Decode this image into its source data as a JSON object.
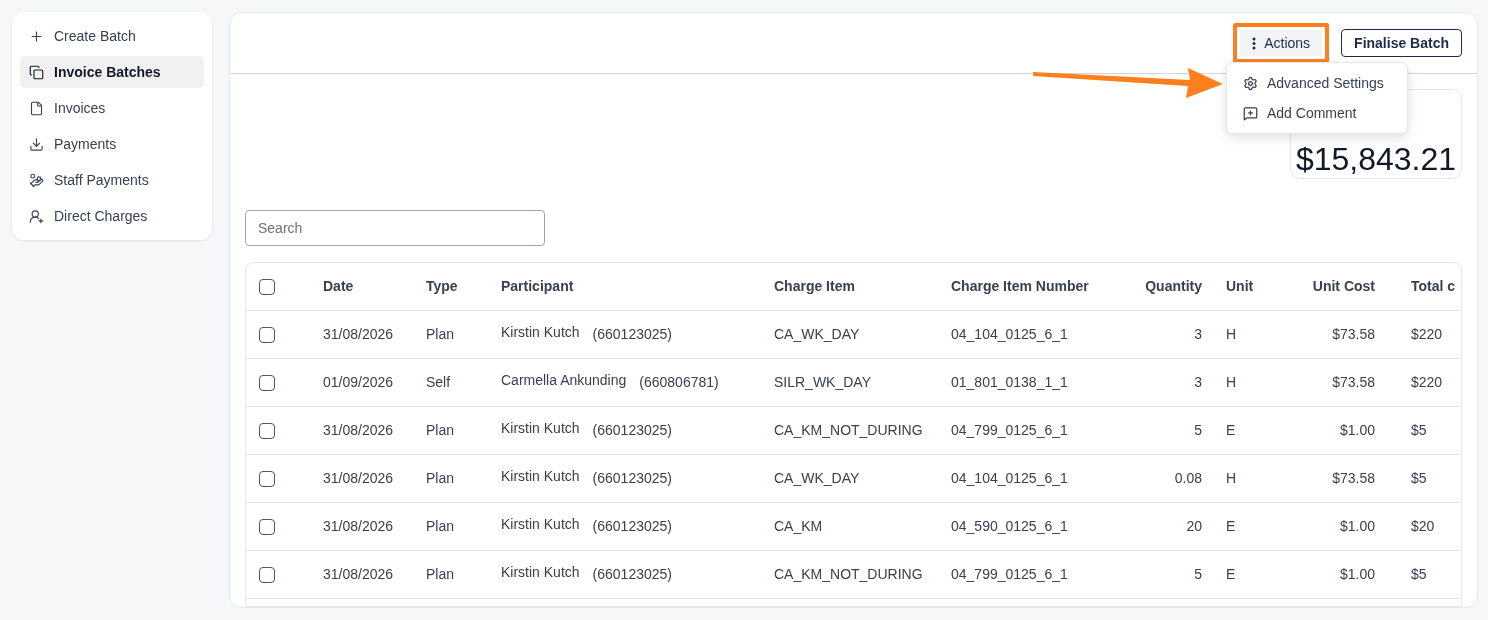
{
  "sidebar": {
    "items": [
      {
        "label": "Create Batch",
        "selected": false
      },
      {
        "label": "Invoice Batches",
        "selected": true
      },
      {
        "label": "Invoices",
        "selected": false
      },
      {
        "label": "Payments",
        "selected": false
      },
      {
        "label": "Staff Payments",
        "selected": false
      },
      {
        "label": "Direct Charges",
        "selected": false
      }
    ]
  },
  "header": {
    "actions_button": {
      "label": "Actions",
      "highlighted": true
    },
    "finalise_button": {
      "label": "Finalise Batch"
    }
  },
  "actions_menu": {
    "open": true,
    "pointed_at": true,
    "items": [
      {
        "label": "Advanced Settings"
      },
      {
        "label": "Add Comment"
      }
    ]
  },
  "summary": {
    "amount": "$15,843.21"
  },
  "search": {
    "placeholder": "Search"
  },
  "table": {
    "all_checked": false,
    "columns": [
      "Date",
      "Type",
      "Participant",
      "Charge Item",
      "Charge Item Number",
      "Quantity",
      "Unit",
      "Unit Cost",
      "Total c"
    ],
    "rows": [
      {
        "checked": false,
        "date": "31/08/2026",
        "type": "Plan",
        "participant": "Kirstin Kutch",
        "participant_id": "(660123025)",
        "charge_item": "CA_WK_DAY",
        "charge_item_number": "04_104_0125_6_1",
        "quantity": "3",
        "unit": "H",
        "unit_cost": "$73.58",
        "total": "$220"
      },
      {
        "checked": false,
        "date": "01/09/2026",
        "type": "Self",
        "participant": "Carmella Ankunding",
        "participant_id": "(660806781)",
        "charge_item": "SILR_WK_DAY",
        "charge_item_number": "01_801_0138_1_1",
        "quantity": "3",
        "unit": "H",
        "unit_cost": "$73.58",
        "total": "$220"
      },
      {
        "checked": false,
        "date": "31/08/2026",
        "type": "Plan",
        "participant": "Kirstin Kutch",
        "participant_id": "(660123025)",
        "charge_item": "CA_KM_NOT_DURING",
        "charge_item_number": "04_799_0125_6_1",
        "quantity": "5",
        "unit": "E",
        "unit_cost": "$1.00",
        "total": "$5"
      },
      {
        "checked": false,
        "date": "31/08/2026",
        "type": "Plan",
        "participant": "Kirstin Kutch",
        "participant_id": "(660123025)",
        "charge_item": "CA_WK_DAY",
        "charge_item_number": "04_104_0125_6_1",
        "quantity": "0.08",
        "unit": "H",
        "unit_cost": "$73.58",
        "total": "$5"
      },
      {
        "checked": false,
        "date": "31/08/2026",
        "type": "Plan",
        "participant": "Kirstin Kutch",
        "participant_id": "(660123025)",
        "charge_item": "CA_KM",
        "charge_item_number": "04_590_0125_6_1",
        "quantity": "20",
        "unit": "E",
        "unit_cost": "$1.00",
        "total": "$20"
      },
      {
        "checked": false,
        "date": "31/08/2026",
        "type": "Plan",
        "participant": "Kirstin Kutch",
        "participant_id": "(660123025)",
        "charge_item": "CA_KM_NOT_DURING",
        "charge_item_number": "04_799_0125_6_1",
        "quantity": "5",
        "unit": "E",
        "unit_cost": "$1.00",
        "total": "$5"
      }
    ]
  }
}
